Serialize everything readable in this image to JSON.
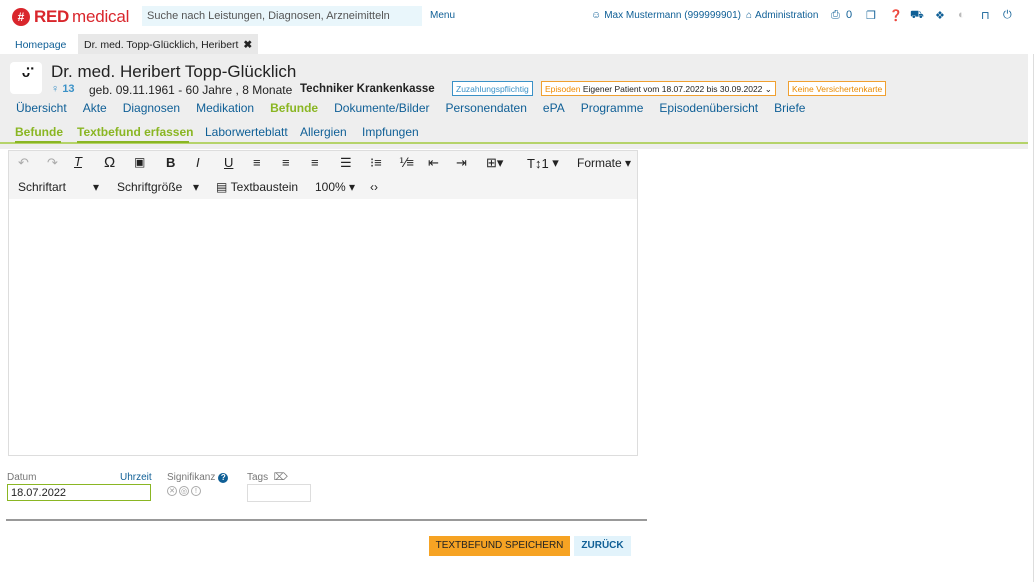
{
  "app": {
    "logo_red": "RED",
    "logo_medical": "medical"
  },
  "topbar": {
    "search_placeholder": "Suche nach Leistungen, Diagnosen, Arzneimitteln",
    "menu_label": "Menu",
    "user_label": "Max Mustermann (999999901)",
    "admin_label": "Administration",
    "print_count": "0"
  },
  "tabs": {
    "home": "Homepage",
    "patient": "Dr. med. Topp-Glücklich, Heribert"
  },
  "patient": {
    "name": "Dr. med. Heribert Topp-Glücklich",
    "id": "13",
    "birth": "geb. 09.11.1961 - 60 Jahre , 8 Monate",
    "insurance": "Techniker Krankenkasse",
    "badge_zuzahlung": "Zuzahlungspflichtig",
    "badge_episode_prefix": "Episoden",
    "badge_episode": "Eigener Patient vom 18.07.2022 bis 30.09.2022",
    "badge_karte": "Keine Versichertenkarte"
  },
  "nav": [
    "Übersicht",
    "Akte",
    "Diagnosen",
    "Medikation",
    "Befunde",
    "Dokumente/Bilder",
    "Personendaten",
    "ePA",
    "Programme",
    "Episodenübersicht",
    "Briefe"
  ],
  "subnav": [
    "Befunde",
    "Textbefund erfassen",
    "Laborwerteblatt",
    "Allergien",
    "Impfungen"
  ],
  "editor": {
    "font_label": "Schriftart",
    "size_label": "Schriftgröße",
    "textbaustein_label": "Textbaustein",
    "zoom": "100%",
    "line_height": "1",
    "formats_label": "Formate"
  },
  "form": {
    "datum_label": "Datum",
    "uhrzeit_label": "Uhrzeit",
    "datum_value": "18.07.2022",
    "signifikanz_label": "Signifikanz",
    "tags_label": "Tags"
  },
  "buttons": {
    "save": "TEXTBEFUND SPEICHERN",
    "back": "ZURÜCK"
  }
}
